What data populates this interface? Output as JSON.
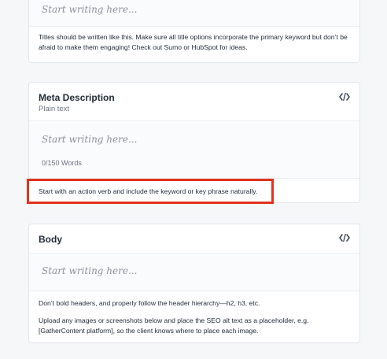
{
  "title_card": {
    "placeholder": "Start writing here...",
    "help_text": "Titles should be written like this. Make sure all title options incorporate the primary keyword but don’t be afraid to make them engaging! Check out Sumo or HubSpot for ideas."
  },
  "meta_card": {
    "title": "Meta Description",
    "subtitle": "Plain text",
    "code_icon": "code-brackets-icon",
    "placeholder": "Start writing here...",
    "word_count": "0/150 Words",
    "help_text": "Start with an action verb and include the keyword or key phrase naturally.",
    "highlight_color": "#e0321e"
  },
  "body_card": {
    "title": "Body",
    "code_icon": "code-brackets-icon",
    "placeholder": "Start writing here...",
    "help_text_1": "Don’t bold headers, and properly follow the header hierarchy—h2, h3, etc.",
    "help_text_2": "Upload any images or screenshots below and place the SEO alt text as a placeholder, e.g. [GatherContent platform], so the client knows where to place each image."
  }
}
